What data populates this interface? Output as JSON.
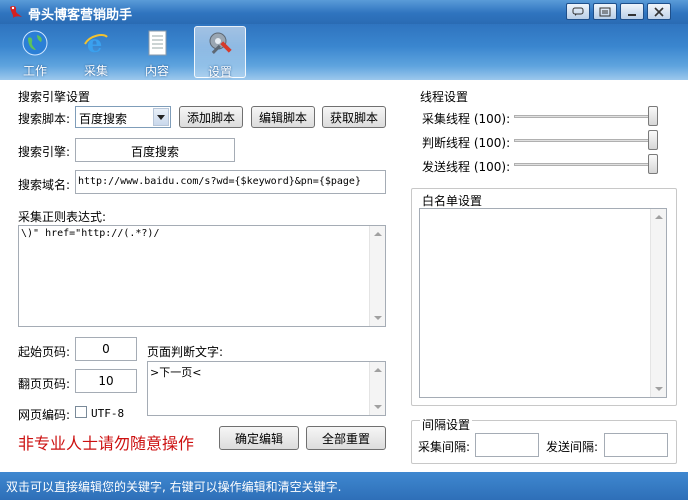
{
  "window": {
    "title": "骨头博客营销助手"
  },
  "toolbar": {
    "items": [
      {
        "label": "工作",
        "icon": "globe-icon"
      },
      {
        "label": "采集",
        "icon": "ie-icon"
      },
      {
        "label": "内容",
        "icon": "document-icon"
      },
      {
        "label": "设置",
        "icon": "tools-icon",
        "active": true
      }
    ]
  },
  "search_engine": {
    "title": "搜索引擎设置",
    "script_label": "搜索脚本:",
    "script_value": "百度搜索",
    "add_script": "添加脚本",
    "edit_script": "编辑脚本",
    "get_script": "获取脚本",
    "engine_label": "搜索引擎:",
    "engine_value": "百度搜索",
    "domain_label": "搜索域名:",
    "domain_value": "http://www.baidu.com/s?wd={$keyword}&pn={$page}",
    "regex_label": "采集正则表达式:",
    "regex_value": "\\)\" href=\"http://(.*?)/",
    "start_page_label": "起始页码:",
    "start_page_value": "0",
    "page_step_label": "翻页页码:",
    "page_step_value": "10",
    "encoding_label": "网页编码:",
    "encoding_option": "UTF-8",
    "encoding_checked": false,
    "page_judge_label": "页面判断文字:",
    "page_judge_value": ">下一页<",
    "warning": "非专业人士请勿随意操作",
    "confirm_edit": "确定编辑",
    "reset_all": "全部重置"
  },
  "threads": {
    "title": "线程设置",
    "collect_label": "采集线程 (100):",
    "judge_label": "判断线程 (100):",
    "send_label": "发送线程 (100):",
    "collect_value": 100,
    "judge_value": 100,
    "send_value": 100
  },
  "whitelist": {
    "title": "白名单设置"
  },
  "interval": {
    "title": "间隔设置",
    "collect_label": "采集间隔:",
    "send_label": "发送间隔:"
  },
  "status": {
    "text": "双击可以直接编辑您的关键字, 右键可以操作编辑和清空关键字."
  },
  "colors": {
    "titlebar": "#2f74bf",
    "warning": "#cc1010"
  }
}
